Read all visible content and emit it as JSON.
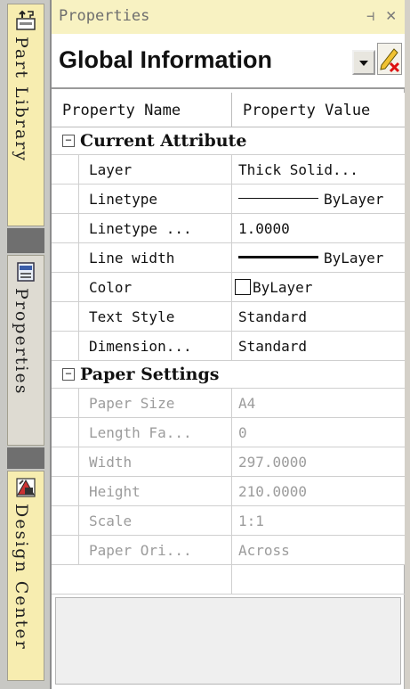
{
  "side_tabs": [
    {
      "label": "Part Library",
      "icon": "part-library-icon"
    },
    {
      "label": "Properties",
      "icon": "properties-icon"
    },
    {
      "label": "Design Center",
      "icon": "design-center-icon"
    }
  ],
  "panel": {
    "title": "Properties",
    "pin_glyph": "⊣",
    "close_glyph": "✕",
    "selector": {
      "value": "Global Information"
    },
    "header": {
      "name_col": "Property Name",
      "value_col": "Property Value"
    },
    "categories": [
      {
        "label": "Current Attribute",
        "expander": "−",
        "rows": [
          {
            "name": "Layer",
            "value": "Thick Solid..."
          },
          {
            "name": "Linetype",
            "value": "ByLayer"
          },
          {
            "name": "Linetype ...",
            "value": "1.0000"
          },
          {
            "name": "Line width",
            "value": "ByLayer"
          },
          {
            "name": "Color",
            "value": "ByLayer"
          },
          {
            "name": "Text Style",
            "value": "Standard"
          },
          {
            "name": "Dimension...",
            "value": "Standard"
          }
        ]
      },
      {
        "label": "Paper Settings",
        "expander": "−",
        "rows": [
          {
            "name": "Paper Size",
            "value": "A4"
          },
          {
            "name": "Length Fa...",
            "value": "0"
          },
          {
            "name": "Width",
            "value": "297.0000"
          },
          {
            "name": "Height",
            "value": "210.0000"
          },
          {
            "name": "Scale",
            "value": "1:1"
          },
          {
            "name": "Paper Ori...",
            "value": "Across"
          }
        ]
      }
    ]
  },
  "colors": {
    "title_bg": "#f8f2c2",
    "active_tab": "#f7edb0",
    "disabled_text": "#9c9c9c"
  }
}
